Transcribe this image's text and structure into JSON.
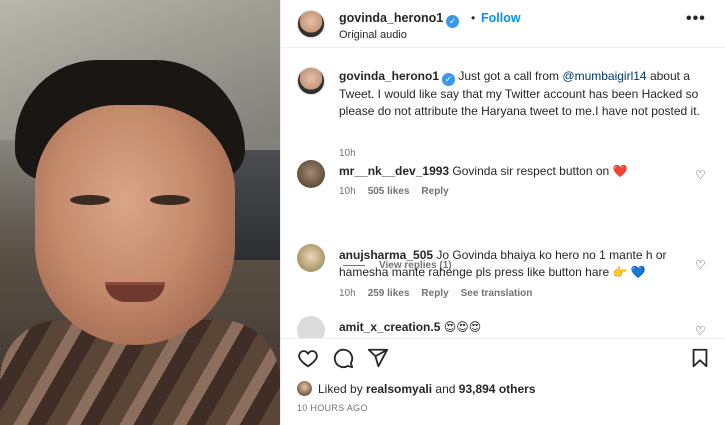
{
  "post": {
    "username": "govinda_herono1",
    "follow_label": "Follow",
    "audio": "Original audio",
    "more_label": "•••",
    "verified_mark": "✓",
    "separator": "•"
  },
  "caption": {
    "username": "govinda_herono1",
    "text_before": " Just got a call from ",
    "mention": "@mumbaigirl14",
    "text_after": " about a Tweet. I would like say that my Twitter account has been Hacked so please do not attribute the Haryana tweet to me.I have not posted it.",
    "time": "10h"
  },
  "comments": [
    {
      "username": "mr__nk__dev_1993",
      "text": " Govinda sir respect button on ",
      "emoji": "❤️",
      "time": "10h",
      "likes": "505 likes",
      "reply_label": "Reply"
    },
    {
      "username": "anujsharma_505",
      "text": " Jo Govinda bhaiya ko hero no 1 mante h or hamesha mante rahenge pls press like button hare ",
      "emoji": "👉 💙",
      "time": "10h",
      "likes": "259 likes",
      "reply_label": "Reply",
      "translation_label": "See translation"
    },
    {
      "username": "amit_x_creation.5",
      "text": " ",
      "emoji": "😍😍😍"
    }
  ],
  "view_replies_label": "View replies (1)",
  "like_icon_glyph": "♡",
  "footer": {
    "liked_by_prefix": "Liked by ",
    "liked_by_user": "realsomyali",
    "liked_by_and": " and ",
    "liked_by_count": "93,894 others",
    "posted_ago": "10 HOURS AGO"
  },
  "icons": [
    "heart-icon",
    "comment-icon",
    "share-icon",
    "bookmark-icon",
    "more-icon",
    "verified-icon"
  ]
}
